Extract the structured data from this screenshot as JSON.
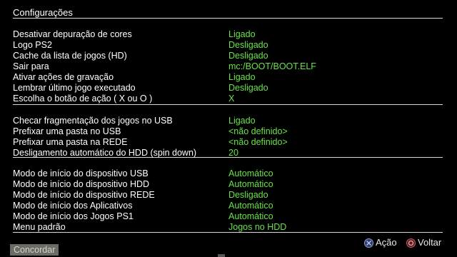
{
  "title": "Configurações",
  "sections": [
    {
      "rows": [
        {
          "label": "Desativar depuração de cores",
          "value": "Ligado"
        },
        {
          "label": "Logo PS2",
          "value": "Desligado"
        },
        {
          "label": "Cache da lista de jogos (HD)",
          "value": "Desligado"
        },
        {
          "label": "Sair para",
          "value": "mc:/BOOT/BOOT.ELF"
        },
        {
          "label": "Ativar ações de gravação",
          "value": "Ligado"
        },
        {
          "label": "Lembrar último jogo executado",
          "value": "Desligado"
        },
        {
          "label": "Escolha o botão de ação ( X ou O )",
          "value": "X"
        }
      ]
    },
    {
      "rows": [
        {
          "label": "Checar fragmentação dos jogos no USB",
          "value": "Ligado"
        },
        {
          "label": "Prefixar uma pasta no USB",
          "value": "<não definido>"
        },
        {
          "label": "Prefixar uma pasta na REDE",
          "value": "<não definido>"
        },
        {
          "label": "Desligamento automático do HDD (spin down)",
          "value": "20"
        }
      ]
    },
    {
      "rows": [
        {
          "label": "Modo de início do dispositivo USB",
          "value": "Automático"
        },
        {
          "label": "Modo de início do dispositivo HDD",
          "value": "Automático"
        },
        {
          "label": "Modo de início do dispositivo REDE",
          "value": "Desligado"
        },
        {
          "label": "Modo de início dos Aplicativos",
          "value": "Automático"
        },
        {
          "label": "Modo de início dos Jogos PS1",
          "value": "Automático"
        },
        {
          "label": "Menu padrão",
          "value": "Jogos no HDD"
        }
      ]
    }
  ],
  "hints": {
    "action_icon": "cross-button-icon",
    "action_label": "Ação",
    "back_icon": "circle-button-icon",
    "back_label": "Voltar"
  },
  "ok_button_label": "Concordar",
  "colors": {
    "background": "#000000",
    "label": "#ffffff",
    "value": "#69e24a",
    "ok_button_bg": "#6c6c64"
  }
}
